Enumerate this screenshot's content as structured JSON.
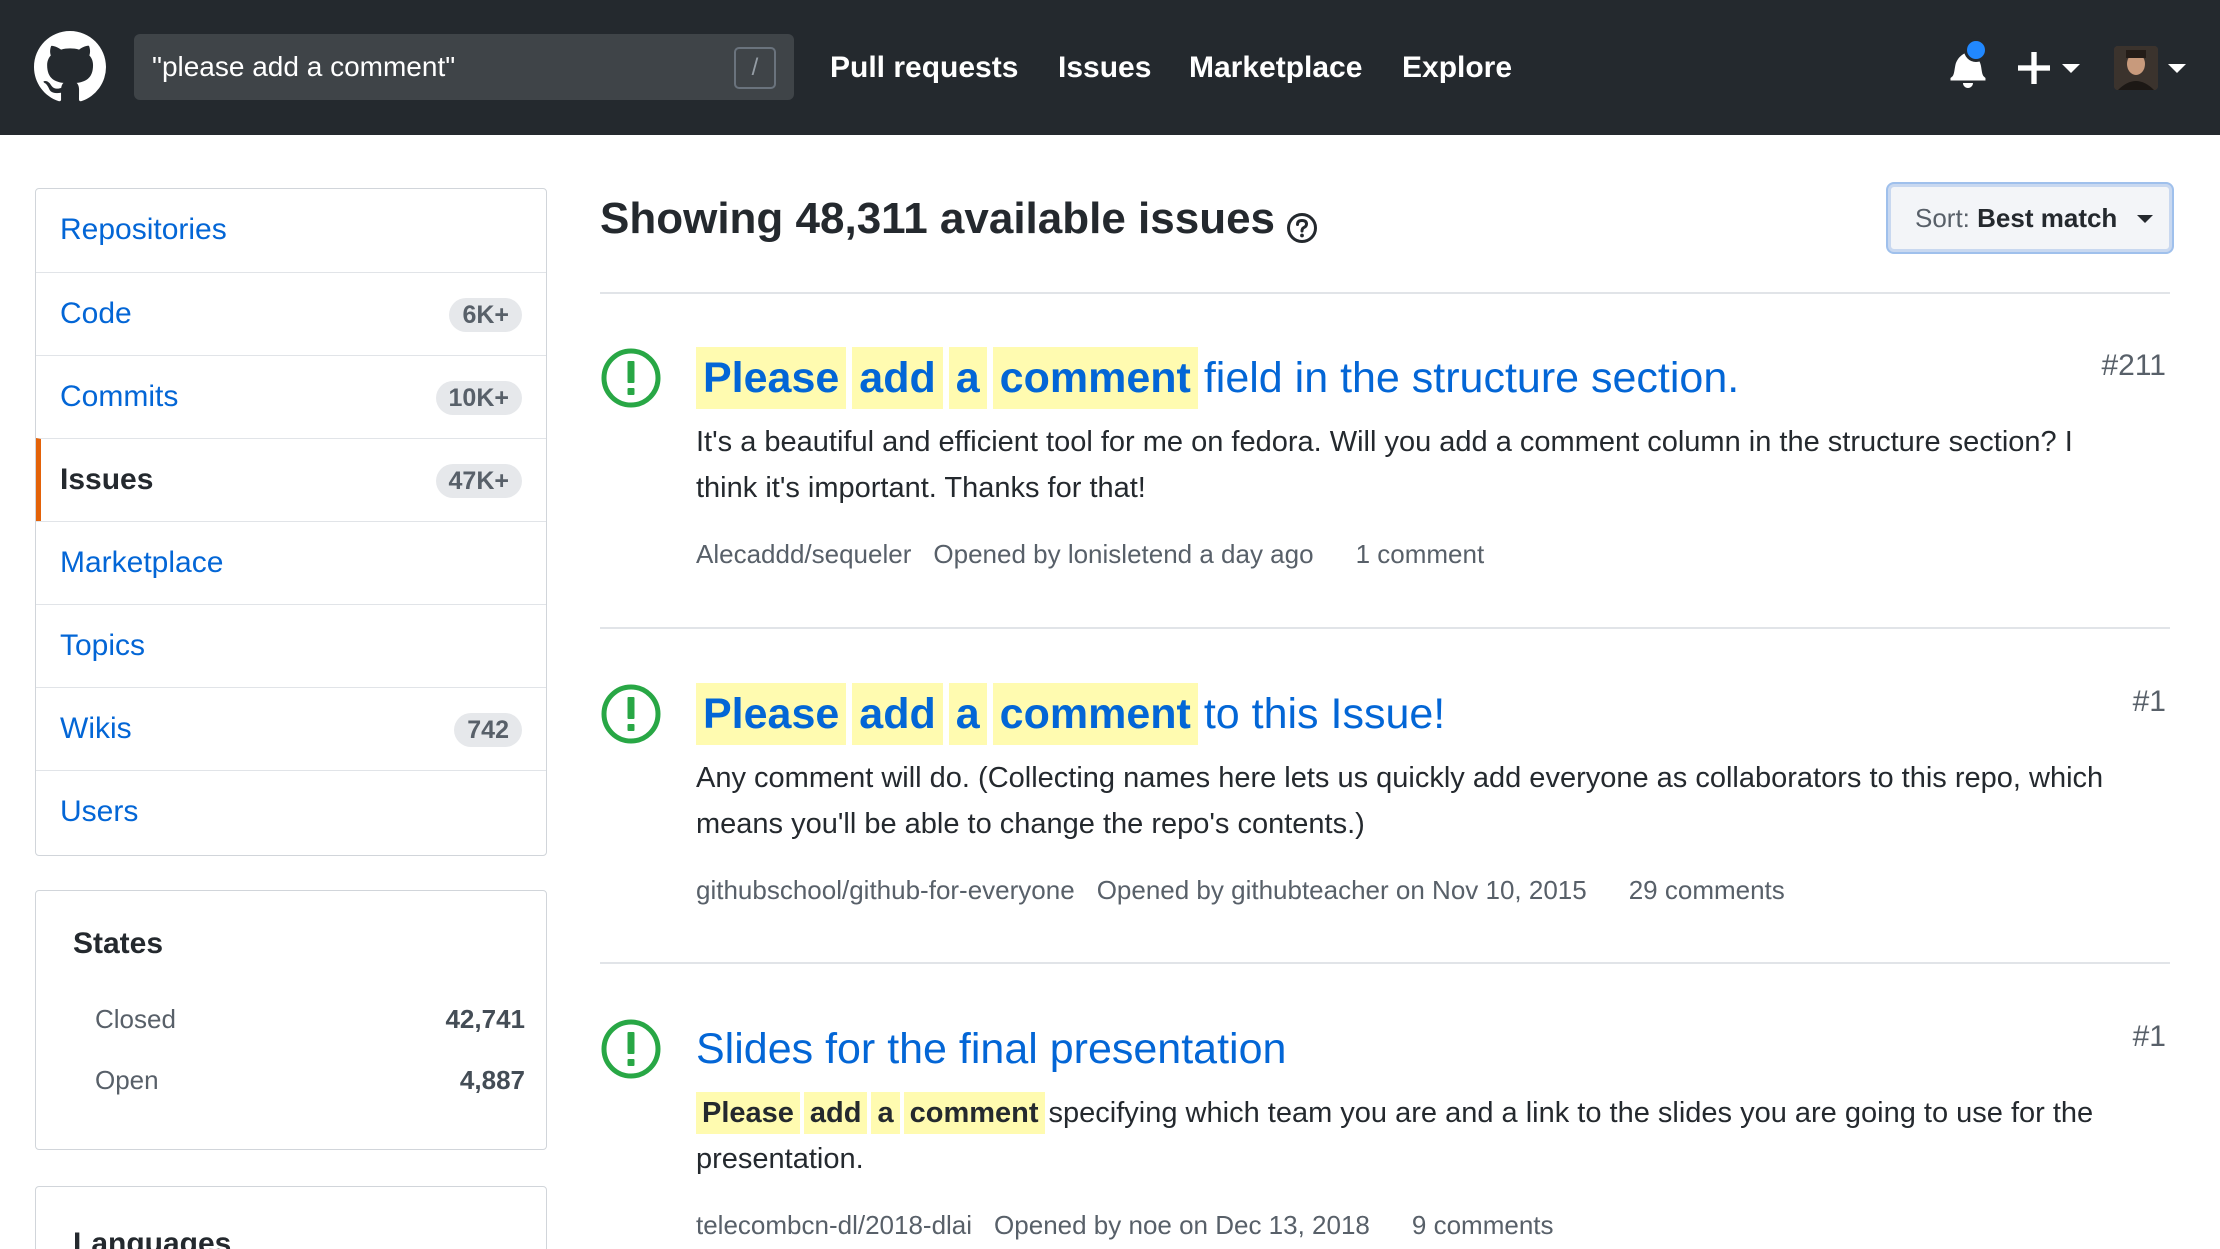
{
  "header": {
    "search_value": "\"please add a comment\"",
    "search_shortcut": "/",
    "nav": [
      "Pull requests",
      "Issues",
      "Marketplace",
      "Explore"
    ],
    "bg_color": "#24292e"
  },
  "sidebar": {
    "filters": [
      {
        "label": "Repositories",
        "count": ""
      },
      {
        "label": "Code",
        "count": "6K+"
      },
      {
        "label": "Commits",
        "count": "10K+"
      },
      {
        "label": "Issues",
        "count": "47K+"
      },
      {
        "label": "Marketplace",
        "count": ""
      },
      {
        "label": "Topics",
        "count": ""
      },
      {
        "label": "Wikis",
        "count": "742"
      },
      {
        "label": "Users",
        "count": ""
      }
    ],
    "selected_filter": "Issues",
    "accent_color": "#e36209",
    "states": {
      "title": "States",
      "rows": [
        {
          "label": "Closed",
          "count": "42,741"
        },
        {
          "label": "Open",
          "count": "4,887"
        }
      ]
    },
    "languages_title": "Languages"
  },
  "results": {
    "title": "Showing 48,311 available issues",
    "sort_prefix": "Sort:",
    "sort_value": "Best match"
  },
  "issues": [
    {
      "title_highlight": [
        "Please",
        "add",
        "a",
        "comment"
      ],
      "title_rest": "field in the structure section.",
      "number": "#211",
      "body_highlight": [],
      "body": "It's a beautiful and efficient tool for me on fedora. Will you add a comment column in the structure section? I think it's important. Thanks for that!",
      "repo": "Alecaddd/sequeler",
      "opened": "Opened by lonisletend a day ago",
      "comments": "1 comment"
    },
    {
      "title_highlight": [
        "Please",
        "add",
        "a",
        "comment"
      ],
      "title_rest": "to this Issue!",
      "number": "#1",
      "body_highlight": [],
      "body": "Any comment will do. (Collecting names here lets us quickly add everyone as collaborators to this repo, which means you'll be able to change the repo's contents.)",
      "repo": "githubschool/github-for-everyone",
      "opened": "Opened by githubteacher on Nov 10, 2015",
      "comments": "29 comments"
    },
    {
      "title_highlight": [],
      "title_rest": "Slides for the final presentation",
      "number": "#1",
      "body_highlight": [
        "Please",
        "add",
        "a",
        "comment"
      ],
      "body": "specifying which team you are and a link to the slides you are going to use for the presentation.",
      "repo": "telecombcn-dl/2018-dlai",
      "opened": "Opened by noe on Dec 13, 2018",
      "comments": "9 comments"
    }
  ],
  "colors": {
    "link": "#0366d6",
    "open_issue": "#28a745",
    "highlight": "#fffbb0"
  }
}
